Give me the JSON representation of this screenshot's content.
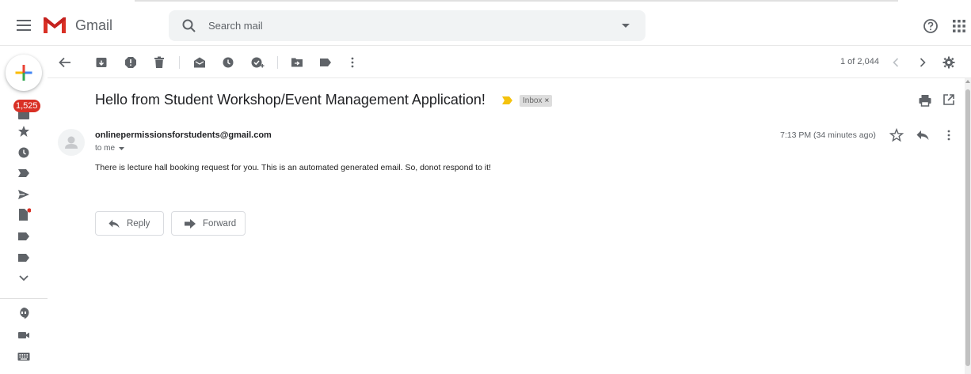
{
  "app": {
    "name": "Gmail"
  },
  "search": {
    "placeholder": "Search mail"
  },
  "sidebar": {
    "unread_count": "1,525"
  },
  "toolbar": {
    "pagination": "1 of 2,044"
  },
  "message": {
    "subject": "Hello from Student Workshop/Event Management Application!",
    "label_chip": "Inbox",
    "label_remove": "×",
    "from": "onlinepermissionsforstudents@gmail.com",
    "to": "to me",
    "time": "7:13 PM (34 minutes ago)",
    "body": "There is lecture hall booking request for you. This is an automated generated email. So, donot respond to it!"
  },
  "actions": {
    "reply_label": "Reply",
    "forward_label": "Forward"
  },
  "colors": {
    "brand_red": "#d93025",
    "important_yellow": "#f4c20d",
    "icon_gray": "#5f6368"
  }
}
